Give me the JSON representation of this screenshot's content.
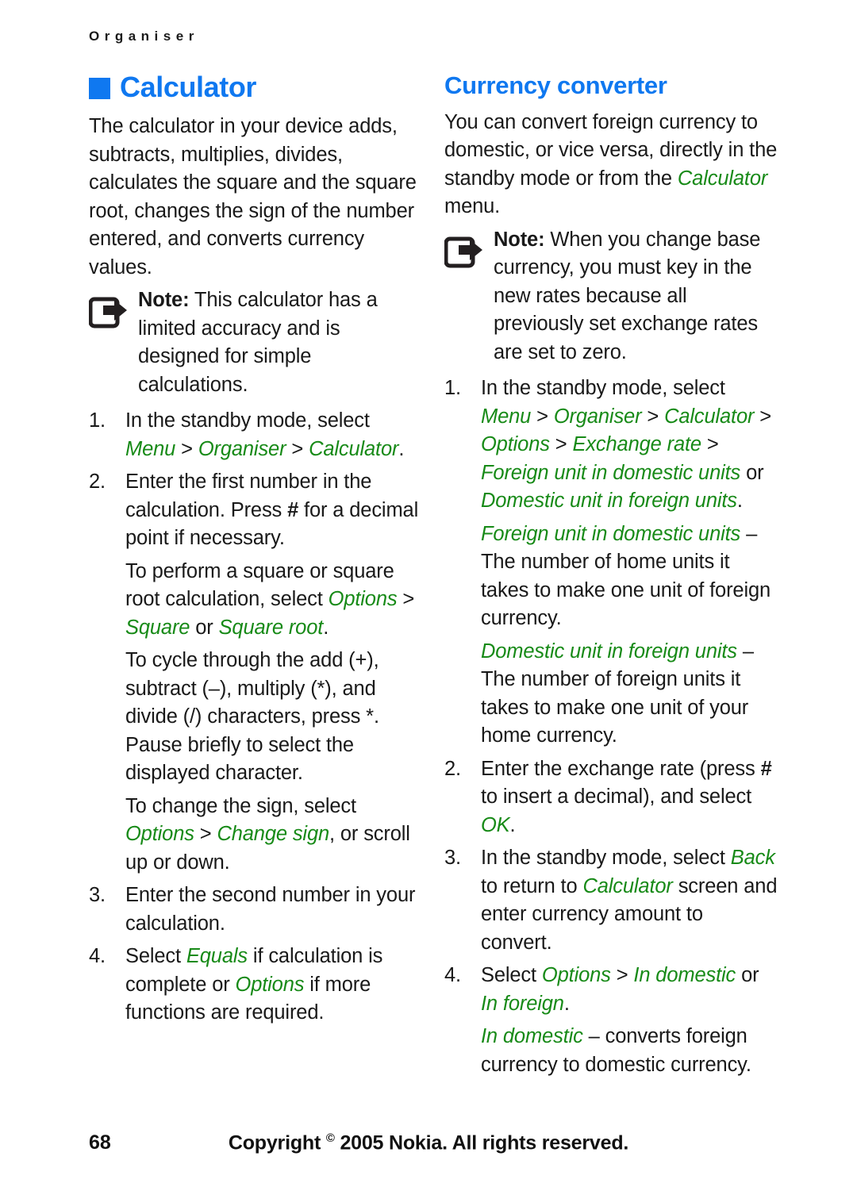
{
  "running_head": "Organiser",
  "colors": {
    "heading_blue": "#0f78f0",
    "ui_green": "#178a17",
    "body_black": "#191919"
  },
  "left_column": {
    "heading": "Calculator",
    "intro": "The calculator in your device adds, subtracts, multiplies, divides, calculates the square and the square root, changes the sign of the number entered, and converts currency values.",
    "note": {
      "icon": "note-arrow-icon",
      "lead": "Note:",
      "text": " This calculator has a limited accuracy and is designed for simple calculations."
    },
    "steps": [
      {
        "num": "1.",
        "text_a": "In the standby mode, select ",
        "ui_1": "Menu",
        "sep_1": " > ",
        "ui_2": "Organiser",
        "sep_2": " > ",
        "ui_3": "Calculator",
        "text_b": "."
      },
      {
        "num": "2.",
        "text_a": "Enter the first number in the calculation. Press ",
        "bold_1": "#",
        "text_b": " for a decimal point if necessary."
      },
      {
        "num": "3.",
        "text_a": "Enter the second number in your calculation."
      },
      {
        "num": "4.",
        "text_a": "Select ",
        "ui_1": "Equals",
        "text_b": " if calculation is complete or ",
        "ui_2": "Options",
        "text_c": " if more functions are required."
      }
    ],
    "sub_paragraphs": [
      {
        "text_a": "To perform a square or square root calculation, select ",
        "ui_1": "Options",
        "sep_1": " > ",
        "ui_2": "Square",
        "text_b": " or ",
        "ui_3": "Square root",
        "text_c": "."
      },
      {
        "text_a": "To cycle through the add (+), subtract (–), multiply (*), and divide (/) characters, press *. Pause briefly to select the displayed character."
      },
      {
        "text_a": "To change the sign, select ",
        "ui_1": "Options",
        "sep_1": " > ",
        "ui_2": "Change sign",
        "text_b": ", or scroll up or down."
      }
    ]
  },
  "right_column": {
    "heading": "Currency converter",
    "intro_a": "You can convert foreign currency to domestic, or vice versa, directly in the standby mode or from the ",
    "intro_ui": "Calculator",
    "intro_b": " menu.",
    "note": {
      "icon": "note-arrow-icon",
      "lead": "Note:",
      "text": " When you change base currency, you must key in the new rates because all previously set exchange rates are set to zero."
    },
    "steps": [
      {
        "num": "1.",
        "text_a": "In the standby mode, select ",
        "ui_1": "Menu",
        "sep_1": " > ",
        "ui_2": "Organiser",
        "sep_2": " > ",
        "ui_3": "Calculator",
        "sep_3": " > ",
        "ui_4": "Options",
        "sep_4": " > ",
        "ui_5": "Exchange rate",
        "sep_5": " > ",
        "ui_6": "Foreign unit in domestic units",
        "text_b": " or ",
        "ui_7": "Domestic unit in foreign units",
        "text_c": "."
      },
      {
        "num": "2.",
        "text_a": "Enter the exchange rate (press ",
        "bold_1": "#",
        "text_b": " to insert a decimal), and select ",
        "ui_1": "OK",
        "text_c": "."
      },
      {
        "num": "3.",
        "text_a": "In the standby mode, select ",
        "ui_1": "Back",
        "text_b": " to return to ",
        "ui_2": "Calculator",
        "text_c": " screen and enter currency amount to convert."
      },
      {
        "num": "4.",
        "text_a": "Select ",
        "ui_1": "Options",
        "sep_1": " > ",
        "ui_2": "In domestic",
        "text_b": " or ",
        "ui_3": "In foreign",
        "text_c": "."
      }
    ],
    "definitions": [
      {
        "term": "Foreign unit in domestic units",
        "dash": " – ",
        "text": "The number of home units it takes to make one unit of foreign currency."
      },
      {
        "term": "Domestic unit in foreign units",
        "dash": " – ",
        "text": "The number of foreign units it takes to make one unit of your home currency."
      },
      {
        "term": "In domestic",
        "dash": " – ",
        "text": "converts foreign currency to domestic currency."
      }
    ]
  },
  "footer": {
    "page_number": "68",
    "copyright_pre": "Copyright ",
    "copyright_symbol": "©",
    "copyright_post": " 2005 Nokia. All rights reserved."
  }
}
